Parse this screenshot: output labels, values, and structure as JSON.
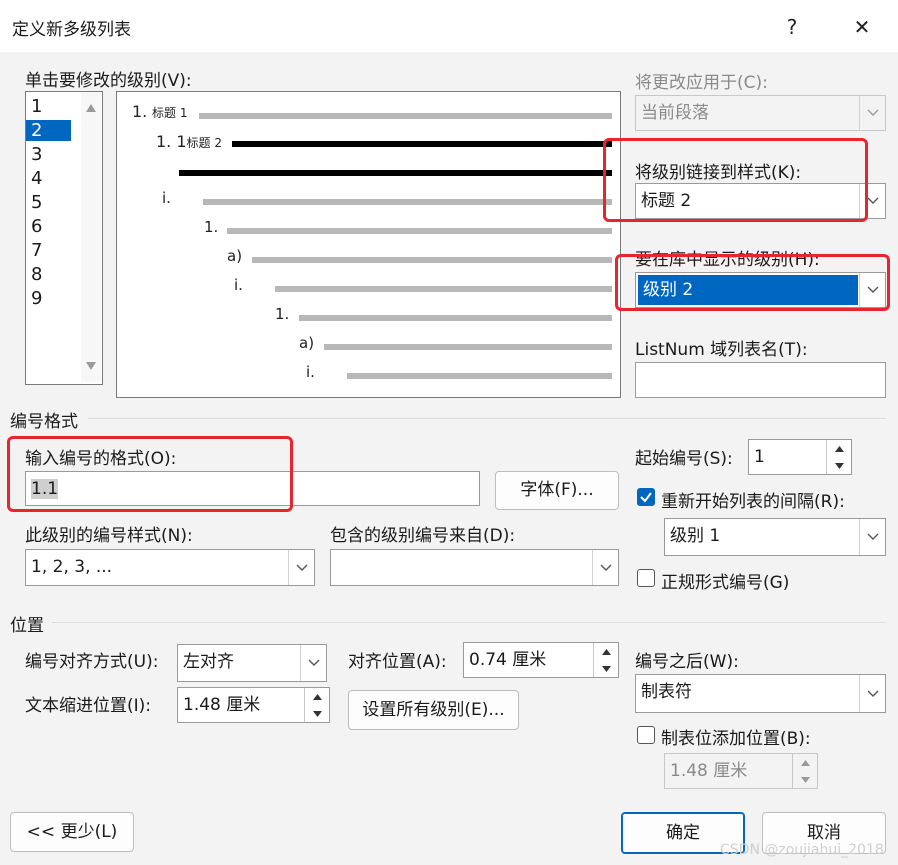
{
  "dialog": {
    "title": "定义新多级列表",
    "help": "?",
    "close": "✕"
  },
  "levels": {
    "label": "单击要修改的级别(V):",
    "items": [
      "1",
      "2",
      "3",
      "4",
      "5",
      "6",
      "7",
      "8",
      "9"
    ],
    "selected": "2"
  },
  "preview": {
    "entries": [
      {
        "num": "1.",
        "text": "标题 1"
      },
      {
        "num": "1. 1",
        "text": "标题 2"
      },
      {
        "num": "i.",
        "text": ""
      },
      {
        "num": "1.",
        "text": ""
      },
      {
        "num": "a)",
        "text": ""
      },
      {
        "num": "i.",
        "text": ""
      },
      {
        "num": "1.",
        "text": ""
      },
      {
        "num": "a)",
        "text": ""
      },
      {
        "num": "i.",
        "text": ""
      }
    ]
  },
  "apply_to": {
    "label": "将更改应用于(C):",
    "value": "当前段落"
  },
  "link_style": {
    "label": "将级别链接到样式(K):",
    "value": "标题 2"
  },
  "gallery_level": {
    "label": "要在库中显示的级别(H):",
    "value": "级别 2"
  },
  "listnum": {
    "label": "ListNum 域列表名(T):",
    "value": ""
  },
  "number_format": {
    "section": "编号格式",
    "enter_label": "输入编号的格式(O):",
    "value": "1.1",
    "font_button": "字体(F)...",
    "style_label": "此级别的编号样式(N):",
    "style_value": "1, 2, 3, ...",
    "include_label": "包含的级别编号来自(D):",
    "include_value": ""
  },
  "start_at": {
    "label": "起始编号(S):",
    "value": "1"
  },
  "restart": {
    "label": "重新开始列表的间隔(R):",
    "checked": true,
    "value": "级别 1"
  },
  "legal": {
    "label": "正规形式编号(G)",
    "checked": false
  },
  "position": {
    "section": "位置",
    "align_label": "编号对齐方式(U):",
    "align_value": "左对齐",
    "aligned_at_label": "对齐位置(A):",
    "aligned_at_value": "0.74 厘米",
    "indent_label": "文本缩进位置(I):",
    "indent_value": "1.48 厘米",
    "set_all_button": "设置所有级别(E)..."
  },
  "follow": {
    "label": "编号之后(W):",
    "value": "制表符",
    "tab_stop_label": "制表位添加位置(B):",
    "tab_stop_checked": false,
    "tab_stop_value": "1.48 厘米"
  },
  "footer": {
    "less_button": "<< 更少(L)",
    "ok_button": "确定",
    "cancel_button": "取消",
    "watermark": "CSDN @zoujiahui_2018"
  }
}
